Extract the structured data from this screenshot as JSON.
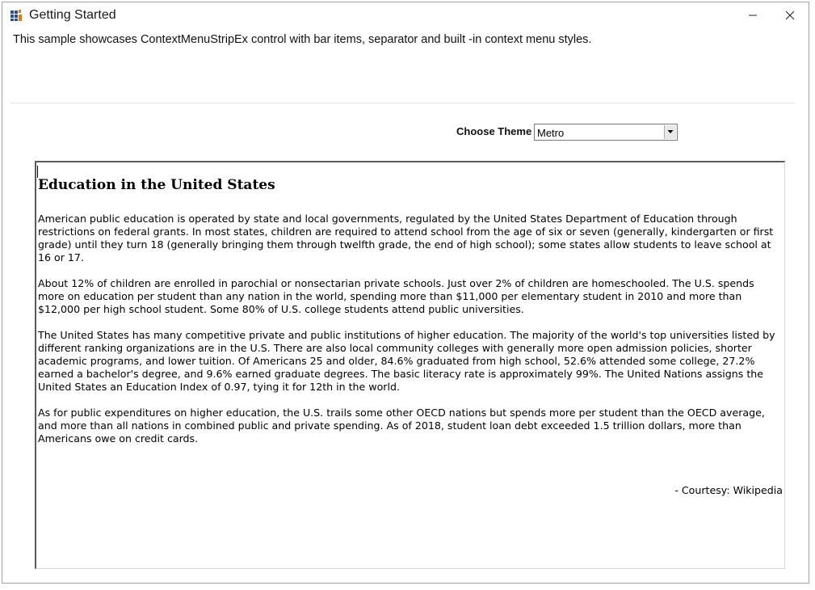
{
  "window": {
    "title": "Getting Started",
    "app_icon": "app-grid-icon",
    "minimize_icon": "minimize-icon",
    "close_icon": "close-icon"
  },
  "description": "This sample showcases ContextMenuStripEx control with bar items, separator and built -in context menu styles.",
  "theme": {
    "label": "Choose Theme",
    "selected": "Metro"
  },
  "document": {
    "heading": "Education in the United States",
    "paragraphs": [
      "American public education is operated by state and local governments, regulated by the United States Department of Education through restrictions on federal grants. In most states, children are required to attend school from the age of six or seven (generally, kindergarten or first grade) until they turn 18 (generally bringing them through twelfth grade, the end of high school); some states allow students to leave school at 16 or 17.",
      "About 12% of children are enrolled in parochial or nonsectarian private schools. Just over 2% of children are homeschooled. The U.S. spends more on education per student than any nation in the world, spending more than $11,000 per elementary student in 2010 and more than $12,000 per high school student. Some 80% of U.S. college students attend public universities.",
      "The United States has many competitive private and public institutions of higher education. The majority of the world's top universities listed by different ranking organizations are in the U.S. There are also local community colleges with generally more open admission policies, shorter academic programs, and lower tuition. Of Americans 25 and older, 84.6% graduated from high school, 52.6% attended some college, 27.2% earned a bachelor's degree, and 9.6% earned graduate degrees. The basic literacy rate is approximately 99%. The United Nations assigns the United States an Education Index of 0.97, tying it for 12th in the world.",
      "As for public expenditures on higher education, the U.S. trails some other OECD nations but spends more per student than the OECD average, and more than all nations in combined public and private spending. As of 2018, student loan debt exceeded 1.5 trillion dollars, more than Americans owe on credit cards."
    ],
    "courtesy": "- Courtesy: Wikipedia"
  }
}
